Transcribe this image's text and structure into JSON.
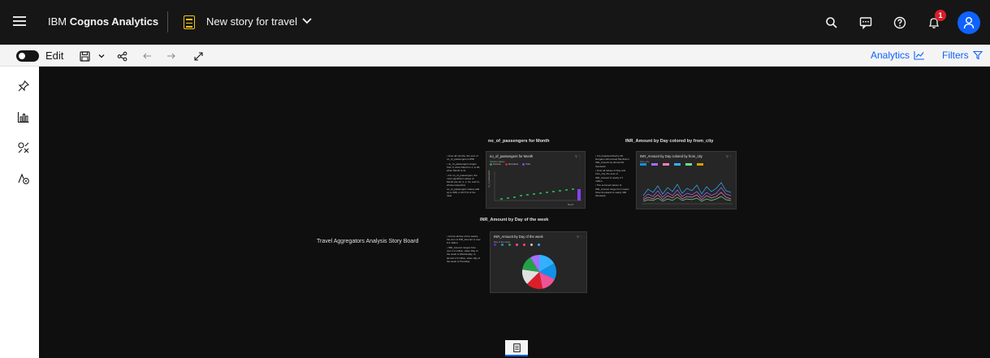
{
  "header": {
    "brand_prefix": "IBM ",
    "brand_product": "Cognos Analytics",
    "story_title": "New story for travel",
    "notification_count": "1"
  },
  "toolbar": {
    "edit_label": "Edit",
    "analytics_label": "Analytics",
    "filters_label": "Filters"
  },
  "canvas": {
    "board_title": "Travel Aggregators Analysis Story Board",
    "section1": {
      "title": "no_of_passengers for Month",
      "bullets": [
        "Over all months, the sum of no_of_passengers is 858.",
        "no_of_passengers ranges from 0, when Month is 1, to 66, when Month is 11.",
        "For no_of_passengers, the most significant values of Month are 12, 2, 1, 10, and 11, whose respective no_of_passengers values add up to 398, or 46.5 % of the total."
      ],
      "card_title": "no_of_passengers for Month",
      "legend_title": "Column values",
      "legend": [
        "Incomes",
        "Decreases",
        "Total"
      ],
      "y_label": "no_of_passengers",
      "x_label": "Month"
    },
    "section2": {
      "title": "INR_Amount by Day colored by from_city",
      "bullets": [
        "It is projected that by 28, Gurgaon will exceed Mumbai in INR_Amount by almost 60 thousand.",
        "Over all values of Day and from_city, the sum of INR_Amount is nearly 4.7 million.",
        "The summed values of INR_Amount range from nearly three thousand to nearly 300 thousand."
      ],
      "card_title": "INR_Amount by Day colored by from_city",
      "legend_title": "from_city"
    },
    "section3": {
      "title": "INR_Amount by Day of the week",
      "bullets": [
        "Across all day of the weeks, the sum of INR_Amount is over 9.3 million.",
        "INR_Amount ranges from over 1.2 million, when Day of the week is Wednesday, to almost 1.5 million, when day of the week is Thursday."
      ],
      "card_title": "INR_Amount by Day of the week",
      "legend_title": "Day of the week"
    }
  },
  "colors": {
    "header_bg": "#161616",
    "accent": "#0f62fe",
    "canvas_bg": "#0f0f0f",
    "story_icon": "#f1c21b",
    "badge": "#da1e28"
  }
}
